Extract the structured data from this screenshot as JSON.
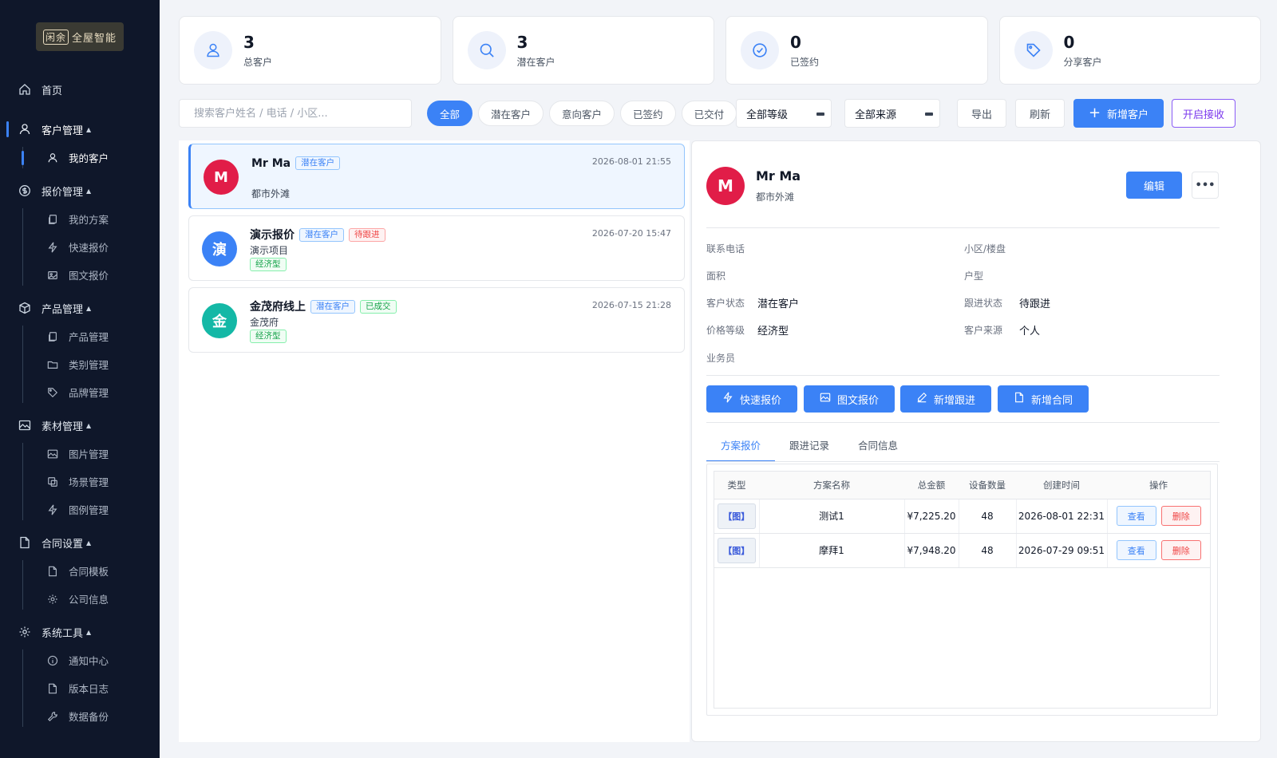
{
  "logo": {
    "mark": "闲余",
    "text": "全屋智能"
  },
  "sidebar": {
    "home": "首页",
    "groups": [
      {
        "label": "客户管理",
        "items": [
          "我的客户"
        ]
      },
      {
        "label": "报价管理",
        "items": [
          "我的方案",
          "快速报价",
          "图文报价"
        ]
      },
      {
        "label": "产品管理",
        "items": [
          "产品管理",
          "类别管理",
          "品牌管理"
        ]
      },
      {
        "label": "素材管理",
        "items": [
          "图片管理",
          "场景管理",
          "图例管理"
        ]
      },
      {
        "label": "合同设置",
        "items": [
          "合同模板",
          "公司信息"
        ]
      },
      {
        "label": "系统工具",
        "items": [
          "通知中心",
          "版本日志",
          "数据备份"
        ]
      }
    ]
  },
  "stats": [
    {
      "num": "3",
      "label": "总客户",
      "icon": "user-icon"
    },
    {
      "num": "3",
      "label": "潜在客户",
      "icon": "search-icon"
    },
    {
      "num": "0",
      "label": "已签约",
      "icon": "check-circle-icon"
    },
    {
      "num": "0",
      "label": "分享客户",
      "icon": "tag-icon"
    }
  ],
  "toolbar": {
    "search_placeholder": "搜索客户姓名 / 电话 / 小区...",
    "filters": [
      "全部",
      "潜在客户",
      "意向客户",
      "已签约",
      "已交付"
    ],
    "level_select": "全部等级",
    "source_select": "全部来源",
    "export": "导出",
    "refresh": "刷新",
    "add_customer": "新增客户",
    "enable_receive": "开启接收"
  },
  "customers": [
    {
      "initial": "M",
      "name": "Mr Ma",
      "status": "潜在客户",
      "follow": "",
      "sub": "都市外滩",
      "grade": "",
      "date": "2026-08-01 21:55",
      "color": "#e11d48"
    },
    {
      "initial": "演",
      "name": "演示报价",
      "status": "潜在客户",
      "follow": "待跟进",
      "sub": "演示项目",
      "grade": "经济型",
      "date": "2026-07-20 15:47",
      "color": "#3b82f6"
    },
    {
      "initial": "金",
      "name": "金茂府线上",
      "status": "潜在客户",
      "follow": "已成交",
      "sub": "金茂府",
      "grade": "经济型",
      "date": "2026-07-15 21:28",
      "color": "#14b8a6"
    }
  ],
  "detail": {
    "initial": "M",
    "name": "Mr Ma",
    "sub": "都市外滩",
    "edit": "编辑",
    "more": "•••",
    "fields": {
      "phone_label": "联系电话",
      "phone": "",
      "community_label": "小区/楼盘",
      "community": "",
      "area_label": "面积",
      "area": "",
      "layout_label": "户型",
      "layout": "",
      "status_label": "客户状态",
      "status": "潜在客户",
      "follow_label": "跟进状态",
      "follow": "待跟进",
      "grade_label": "价格等级",
      "grade": "经济型",
      "source_label": "客户来源",
      "source": "个人",
      "sales_label": "业务员",
      "sales": ""
    },
    "actions": [
      "快速报价",
      "图文报价",
      "新增跟进",
      "新增合同"
    ],
    "tabs": [
      "方案报价",
      "跟进记录",
      "合同信息"
    ],
    "table": {
      "headers": [
        "类型",
        "方案名称",
        "总金额",
        "设备数量",
        "创建时间",
        "操作"
      ],
      "rows": [
        {
          "type": "【图】",
          "name": "测试1",
          "amount": "¥7,225.20",
          "count": "48",
          "created": "2026-08-01 22:31"
        },
        {
          "type": "【图】",
          "name": "摩拜1",
          "amount": "¥7,948.20",
          "count": "48",
          "created": "2026-07-29 09:51"
        }
      ],
      "view": "查看",
      "delete": "删除"
    }
  },
  "colors": {
    "primary": "#3b82f6",
    "sidebar": "#0f172a",
    "danger": "#ef4444",
    "success": "#16a34a",
    "purple": "#7c3aed"
  }
}
